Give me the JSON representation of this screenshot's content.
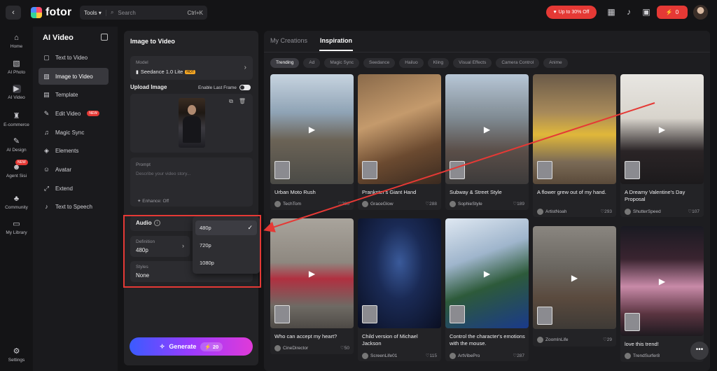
{
  "topbar": {
    "logo_text": "fotor",
    "tools_label": "Tools",
    "search_placeholder": "Search",
    "search_shortcut": "Ctrl+K",
    "promo_label": "Up to 30% Off",
    "credits": "0",
    "brand_red": "#e53935"
  },
  "leftnav": [
    {
      "label": "Home",
      "icon": "home-icon"
    },
    {
      "label": "AI Photo",
      "icon": "photo-icon"
    },
    {
      "label": "AI Video",
      "icon": "video-icon"
    },
    {
      "label": "E-commerce",
      "icon": "shirt-icon"
    },
    {
      "label": "AI Design",
      "icon": "design-icon"
    },
    {
      "label": "Agent Sisi",
      "icon": "agent-icon",
      "badge": "NEW"
    },
    {
      "label": "Community",
      "icon": "community-icon"
    },
    {
      "label": "My Library",
      "icon": "folder-icon"
    },
    {
      "label": "Settings",
      "icon": "gear-icon"
    }
  ],
  "sidepanel": {
    "title": "AI Video",
    "items": [
      {
        "label": "Text to Video"
      },
      {
        "label": "Image to Video"
      },
      {
        "label": "Template"
      },
      {
        "label": "Edit Video",
        "badge": "NEW"
      },
      {
        "label": "Magic Sync"
      },
      {
        "label": "Elements"
      },
      {
        "label": "Avatar"
      },
      {
        "label": "Extend"
      },
      {
        "label": "Text to Speech"
      }
    ]
  },
  "form": {
    "title": "Image to Video",
    "model_label": "Model",
    "model_value": "Seedance 1.0 Lite",
    "model_badge": "HOT",
    "upload_label": "Upload Image",
    "last_frame_label": "Enable Last Frame",
    "prompt_label": "Prompt",
    "prompt_placeholder": "Describe your video story...",
    "enhance_label": "Enhance: Off",
    "audio_label": "Audio",
    "definition_label": "Definition",
    "definition_value": "480p",
    "styles_label": "Styles",
    "styles_value": "None",
    "definition_options": [
      "480p",
      "720p",
      "1080p"
    ],
    "definition_selected": "480p",
    "generate_label": "Generate",
    "generate_cost": "20"
  },
  "gallery": {
    "tabs": [
      "My Creations",
      "Inspiration"
    ],
    "active_tab": "Inspiration",
    "chips": [
      "Trending",
      "Ad",
      "Magic Sync",
      "Seedance",
      "Hailuo",
      "Kling",
      "Visual Effects",
      "Camera Control",
      "Anime"
    ],
    "active_chip": "Trending",
    "cards": [
      {
        "title": "Urban Moto Rush",
        "author": "TechTom",
        "likes": "200"
      },
      {
        "title": "Prankster's Giant Hand",
        "author": "GraceGlow",
        "likes": "288"
      },
      {
        "title": "Subway & Street Style",
        "author": "SophieStyle",
        "likes": "189"
      },
      {
        "title": "A flower grew out of my hand.",
        "author": "ArtistNoah",
        "likes": "293"
      },
      {
        "title": "A Dreamy Valentine's Day Proposal",
        "author": "ShutterSpeed",
        "likes": "107"
      },
      {
        "title": "Who can accept my heart?",
        "author": "CineDirector",
        "likes": "50"
      },
      {
        "title": "Child version of Michael Jackson",
        "author": "ScreenLife01",
        "likes": "115"
      },
      {
        "title": "Control the character's emotions with the mouse.",
        "author": "ArtVibePro",
        "likes": "287"
      },
      {
        "title": "",
        "author": "ZoomInLife",
        "likes": "29"
      },
      {
        "title": "love this trend!",
        "author": "TrendSurfer8",
        "likes": ""
      }
    ]
  }
}
